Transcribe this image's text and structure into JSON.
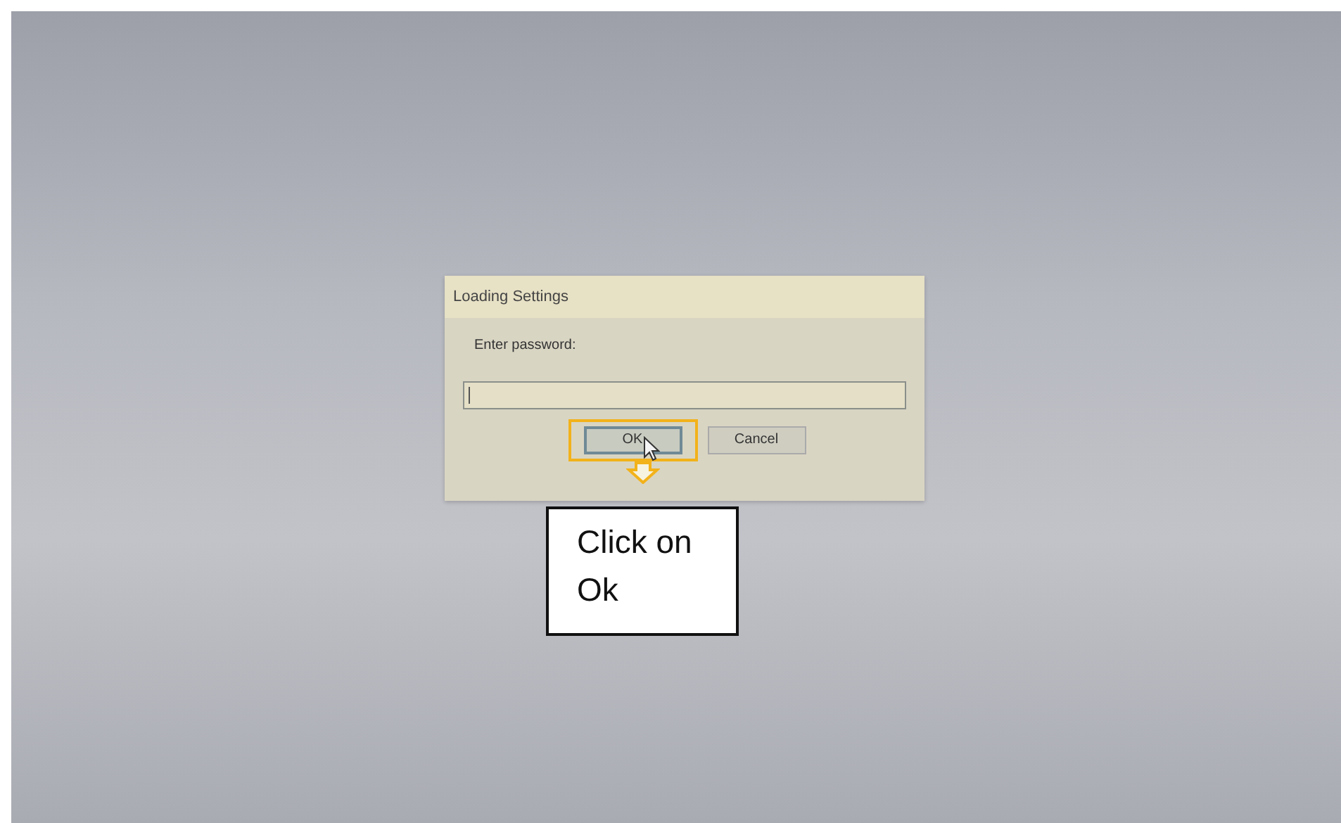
{
  "dialog": {
    "title": "Loading Settings",
    "prompt": "Enter password:",
    "password_field": {
      "focused": true
    },
    "buttons": [
      {
        "label": "OK",
        "default": true,
        "highlighted": true
      },
      {
        "label": "Cancel",
        "default": false,
        "highlighted": false
      }
    ]
  },
  "callout": {
    "text": "Click on Ok"
  }
}
